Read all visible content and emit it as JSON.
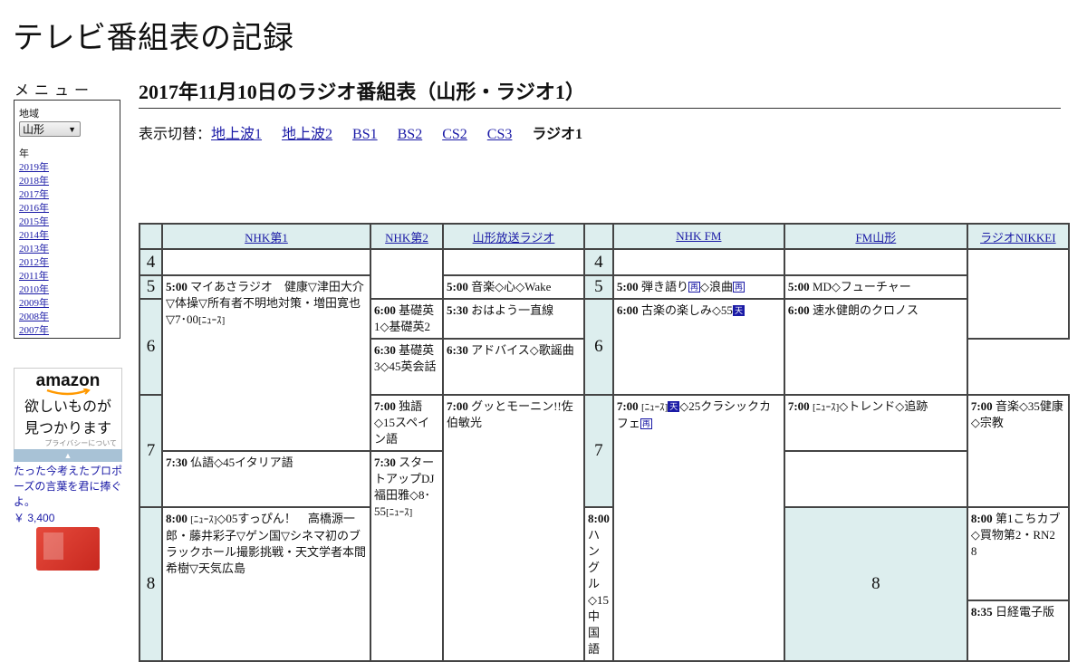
{
  "site": {
    "title": "テレビ番組表の記録"
  },
  "sidebar": {
    "menu_title": "メニュー",
    "region_label": "地域",
    "region_value": "山形",
    "year_label": "年",
    "years": [
      "2019年",
      "2018年",
      "2017年",
      "2016年",
      "2015年",
      "2014年",
      "2013年",
      "2012年",
      "2011年",
      "2010年",
      "2009年",
      "2008年",
      "2007年"
    ]
  },
  "ad": {
    "logo": "amazon",
    "line1": "欲しいものが",
    "line2": "見つかります",
    "privacy": "プライバシーについて",
    "caption": "たった今考えたプロポーズの言葉を君に捧ぐよ。",
    "price": "￥ 3,400"
  },
  "main": {
    "heading": "2017年11月10日のラジオ番組表（山形・ラジオ1）",
    "switch_label": "表示切替：",
    "links": [
      "地上波1",
      "地上波2",
      "BS1",
      "BS2",
      "CS2",
      "CS3"
    ],
    "current": "ラジオ1"
  },
  "schedule": {
    "channels": [
      "NHK第1",
      "NHK第2",
      "山形放送ラジオ",
      "NHK FM",
      "FM山形",
      "ラジオNIKKEI"
    ],
    "hours": [
      "4",
      "5",
      "6",
      "7",
      "8"
    ],
    "programs": {
      "nhk1_5": {
        "time": "5:00",
        "title": "マイあさラジオ　健康▽津田大介▽体操▽所有者不明地対策・増田寛也▽7･00",
        "tail": "[ﾆｭｰｽ]"
      },
      "nhk1_8": {
        "time": "8:00",
        "pre": "[ﾆｭｰｽ]",
        "title": "◇05すっぴん！　高橋源一郎・藤井彩子▽ゲン国▽シネマ初のブラックホール撮影挑戦・天文学者本間希樹▽天気広島"
      },
      "nhk2_600": {
        "time": "6:00",
        "title": "基礎英1◇基礎英2"
      },
      "nhk2_630": {
        "time": "6:30",
        "title": "基礎英3◇45英会話"
      },
      "nhk2_700": {
        "time": "7:00",
        "title": "独語◇15スペイン語"
      },
      "nhk2_730": {
        "time": "7:30",
        "title": "仏語◇45イタリア語"
      },
      "nhk2_800": {
        "time": "8:00",
        "title": "ハングル◇15中国語"
      },
      "ybc_500": {
        "time": "5:00",
        "title": "音楽◇心◇Wake"
      },
      "ybc_530": {
        "time": "5:30",
        "title": "おはよう一直線"
      },
      "ybc_630": {
        "time": "6:30",
        "title": "アドバイス◇歌謡曲"
      },
      "ybc_700": {
        "time": "7:00",
        "title": "グッとモーニン!!佐伯敏光"
      },
      "fm_500": {
        "time": "5:00",
        "title": "弾き語り",
        "mark1": "再",
        "mid": "◇浪曲",
        "mark2": "再"
      },
      "fm_600": {
        "time": "6:00",
        "title": "古楽の楽しみ◇55",
        "mark1": "天"
      },
      "fm_700": {
        "time": "7:00",
        "pre": "[ﾆｭｰｽ]",
        "mark1": "天",
        "title": "◇25クラシックカフェ",
        "mark2": "再"
      },
      "fmy_500": {
        "time": "5:00",
        "title": "MD◇フューチャー"
      },
      "fmy_600": {
        "time": "6:00",
        "title": "速水健朗のクロノス"
      },
      "fmy_700": {
        "time": "7:00",
        "pre": "[ﾆｭｰｽ]",
        "title": "◇トレンド◇追跡"
      },
      "fmy_730": {
        "time": "7:30",
        "title": "スタートアップDJ福田雅◇8･55",
        "tail": "[ﾆｭｰｽ]"
      },
      "nikkei_700": {
        "time": "7:00",
        "title": "音楽◇35健康◇宗教"
      },
      "nikkei_800": {
        "time": "8:00",
        "title": "第1こちカブ◇買物第2・RN2　8"
      },
      "nikkei_830": {
        "time": "8:35",
        "title": "日経電子版"
      }
    }
  },
  "colors": {
    "header_bg": "#ddeeee",
    "link": "#1a1aa6"
  }
}
